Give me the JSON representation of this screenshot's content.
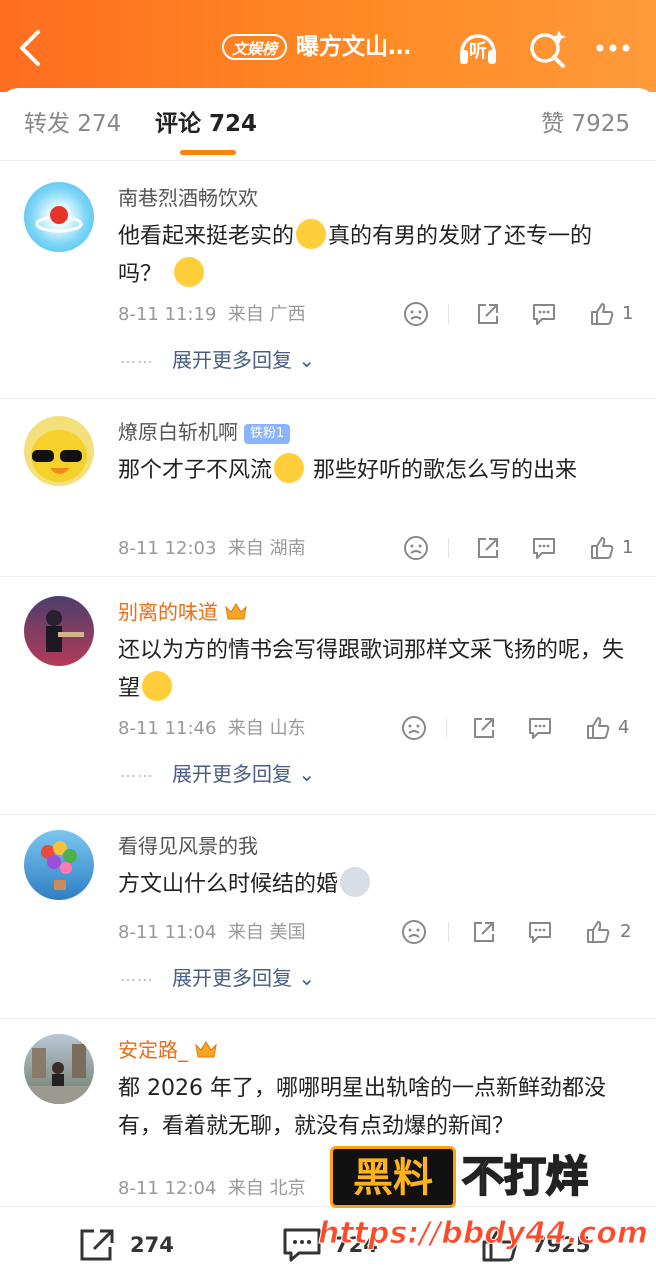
{
  "header": {
    "tag": "文娱榜",
    "title": "曝方文山…",
    "back_icon": "back-arrow-icon",
    "listen_label": "听",
    "search_icon": "search-sparkle-icon",
    "more_icon": "more-dots-icon",
    "accent": "#ff7a1f"
  },
  "tabs": {
    "forward": "转发 274",
    "comment": "评论 724",
    "like": "赞 7925",
    "active_color": "#ff8200"
  },
  "comments": [
    {
      "user": "南巷烈酒畅饮欢",
      "text_a": "他看起来挺老实的",
      "text_b": "真的有男的发财了还专一的吗？",
      "time": "8-11 11:19",
      "from": "来自 广西",
      "likes": "1",
      "more": "展开更多回复"
    },
    {
      "user": "燎原白斩机啊",
      "badge": "铁粉1",
      "text_a": "那个才子不风流",
      "text_b": " 那些好听的歌怎么写的出来",
      "time": "8-11 12:03",
      "from": "来自 湖南",
      "likes": "1"
    },
    {
      "user": "别离的味道",
      "text_a": "还以为方的情书会写得跟歌词那样文采飞扬的呢，失望",
      "time": "8-11 11:46",
      "from": "来自 山东",
      "likes": "4",
      "more": "展开更多回复"
    },
    {
      "user": "看得见风景的我",
      "text_a": "方文山什么时候结的婚",
      "time": "8-11 11:04",
      "from": "来自 美国",
      "likes": "2",
      "more": "展开更多回复"
    },
    {
      "user": "安定路_",
      "text_a": "都 2026 年了，哪哪明星出轨啥的一点新鲜劲都没有，看着就无聊，就没有点劲爆的新闻？",
      "time": "8-11 12:04",
      "from": "来自 北京"
    }
  ],
  "more_dots": "⋯⋯",
  "bottom_bar": {
    "forward_count": "274",
    "comment_count": "724",
    "like_count": "7925"
  },
  "watermark": {
    "box": "黑料",
    "text": "不打烊",
    "url": "https://bbdy44.com"
  }
}
